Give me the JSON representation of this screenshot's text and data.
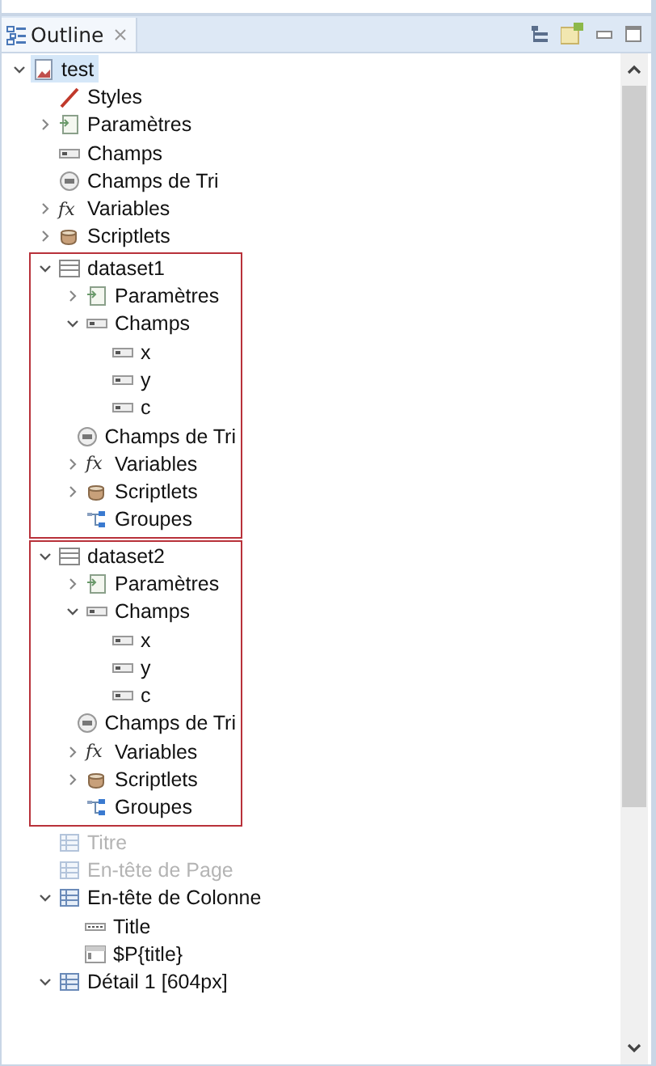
{
  "view": {
    "title": "Outline"
  },
  "tree": [
    {
      "label": "test",
      "kind": "report",
      "expanded": true,
      "selected": true,
      "disabled": false,
      "framed": false,
      "children": [
        {
          "label": "Styles",
          "kind": "styles",
          "selected": false,
          "disabled": false,
          "framed": false
        },
        {
          "label": "Paramètres",
          "kind": "params",
          "expanded": false,
          "selected": false,
          "disabled": false,
          "framed": false
        },
        {
          "label": "Champs",
          "kind": "field",
          "selected": false,
          "disabled": false,
          "framed": false
        },
        {
          "label": "Champs de Tri",
          "kind": "sortfield",
          "selected": false,
          "disabled": false,
          "framed": false
        },
        {
          "label": "Variables",
          "kind": "variables",
          "glyph": "fx",
          "expanded": false,
          "selected": false,
          "disabled": false,
          "framed": false
        },
        {
          "label": "Scriptlets",
          "kind": "scriptlets",
          "expanded": false,
          "selected": false,
          "disabled": false,
          "framed": false
        },
        {
          "label": "dataset1",
          "kind": "dataset",
          "expanded": true,
          "selected": false,
          "disabled": false,
          "framed": true,
          "children": [
            {
              "label": "Paramètres",
              "kind": "params",
              "expanded": false,
              "selected": false,
              "disabled": false,
              "framed": false
            },
            {
              "label": "Champs",
              "kind": "field",
              "expanded": true,
              "selected": false,
              "disabled": false,
              "framed": false,
              "children": [
                {
                  "label": "x",
                  "kind": "field",
                  "selected": false,
                  "disabled": false,
                  "framed": false
                },
                {
                  "label": "y",
                  "kind": "field",
                  "selected": false,
                  "disabled": false,
                  "framed": false
                },
                {
                  "label": "c",
                  "kind": "field",
                  "selected": false,
                  "disabled": false,
                  "framed": false
                }
              ]
            },
            {
              "label": "Champs de Tri",
              "kind": "sortfield",
              "selected": false,
              "disabled": false,
              "framed": false
            },
            {
              "label": "Variables",
              "kind": "variables",
              "glyph": "fx",
              "expanded": false,
              "selected": false,
              "disabled": false,
              "framed": false
            },
            {
              "label": "Scriptlets",
              "kind": "scriptlets",
              "expanded": false,
              "selected": false,
              "disabled": false,
              "framed": false
            },
            {
              "label": "Groupes",
              "kind": "groups",
              "selected": false,
              "disabled": false,
              "framed": false
            }
          ]
        },
        {
          "label": "dataset2",
          "kind": "dataset",
          "expanded": true,
          "selected": false,
          "disabled": false,
          "framed": true,
          "children": [
            {
              "label": "Paramètres",
              "kind": "params",
              "expanded": false,
              "selected": false,
              "disabled": false,
              "framed": false
            },
            {
              "label": "Champs",
              "kind": "field",
              "expanded": true,
              "selected": false,
              "disabled": false,
              "framed": false,
              "children": [
                {
                  "label": "x",
                  "kind": "field",
                  "selected": false,
                  "disabled": false,
                  "framed": false
                },
                {
                  "label": "y",
                  "kind": "field",
                  "selected": false,
                  "disabled": false,
                  "framed": false
                },
                {
                  "label": "c",
                  "kind": "field",
                  "selected": false,
                  "disabled": false,
                  "framed": false
                }
              ]
            },
            {
              "label": "Champs de Tri",
              "kind": "sortfield",
              "selected": false,
              "disabled": false,
              "framed": false
            },
            {
              "label": "Variables",
              "kind": "variables",
              "glyph": "fx",
              "expanded": false,
              "selected": false,
              "disabled": false,
              "framed": false
            },
            {
              "label": "Scriptlets",
              "kind": "scriptlets",
              "expanded": false,
              "selected": false,
              "disabled": false,
              "framed": false
            },
            {
              "label": "Groupes",
              "kind": "groups",
              "selected": false,
              "disabled": false,
              "framed": false
            }
          ]
        },
        {
          "label": "Titre",
          "kind": "band",
          "selected": false,
          "disabled": true,
          "framed": false
        },
        {
          "label": "En-tête de Page",
          "kind": "band",
          "selected": false,
          "disabled": true,
          "framed": false
        },
        {
          "label": "En-tête de Colonne",
          "kind": "band",
          "expanded": true,
          "selected": false,
          "disabled": false,
          "framed": false,
          "children": [
            {
              "label": "Title",
              "kind": "label",
              "selected": false,
              "disabled": false,
              "framed": false
            },
            {
              "label": "$P{title}",
              "kind": "textfield",
              "selected": false,
              "disabled": false,
              "framed": false
            }
          ]
        },
        {
          "label": "Détail 1 [604px]",
          "kind": "band",
          "expanded": true,
          "selected": false,
          "disabled": false,
          "framed": false
        }
      ]
    }
  ]
}
